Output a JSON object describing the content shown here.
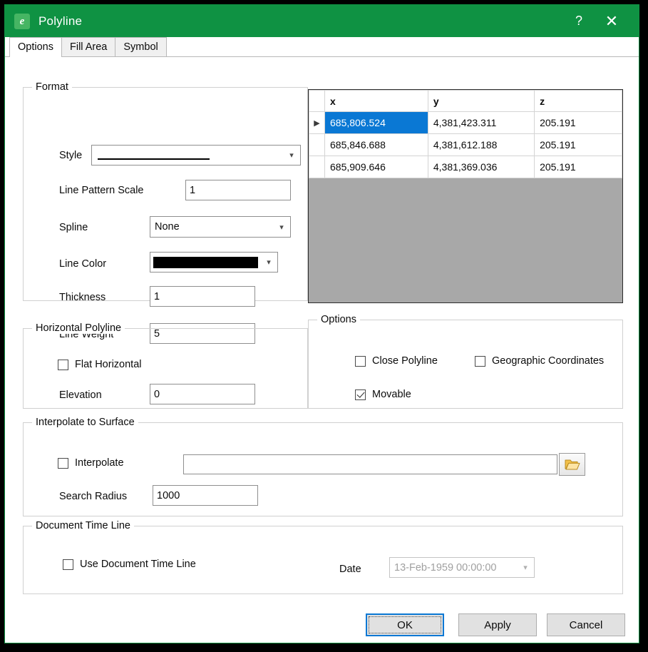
{
  "window": {
    "title": "Polyline",
    "icon": "app-icon-e",
    "help_label": "?",
    "close_label": "✕",
    "accent_color": "#0f9243"
  },
  "tabs": [
    {
      "label": "Options",
      "active": true
    },
    {
      "label": "Fill Area",
      "active": false
    },
    {
      "label": "Symbol",
      "active": false
    }
  ],
  "format": {
    "legend": "Format",
    "style_label": "Style",
    "style_value": "",
    "line_pattern_scale_label": "Line Pattern Scale",
    "line_pattern_scale_value": "1",
    "spline_label": "Spline",
    "spline_value": "None",
    "line_color_label": "Line Color",
    "line_color_value": "#000000",
    "thickness_label": "Thickness",
    "thickness_value": "1",
    "line_weight_label": "Line Weight",
    "line_weight_value": "5"
  },
  "horizontal_polyline": {
    "legend": "Horizontal Polyline",
    "flat_horizontal_label": "Flat Horizontal",
    "flat_horizontal_checked": false,
    "elevation_label": "Elevation",
    "elevation_value": "0"
  },
  "options": {
    "legend": "Options",
    "close_polyline_label": "Close Polyline",
    "close_polyline_checked": false,
    "geographic_coordinates_label": "Geographic Coordinates",
    "geographic_coordinates_checked": false,
    "movable_label": "Movable",
    "movable_checked": true
  },
  "interpolate": {
    "legend": "Interpolate to Surface",
    "interpolate_label": "Interpolate",
    "interpolate_checked": false,
    "surface_path_value": "",
    "browse_icon": "folder-open-icon",
    "search_radius_label": "Search Radius",
    "search_radius_value": "1000"
  },
  "document_time_line": {
    "legend": "Document Time Line",
    "use_label": "Use Document Time Line",
    "use_checked": false,
    "date_label": "Date",
    "date_value": "13-Feb-1959 00:00:00"
  },
  "coordinates_grid": {
    "columns": [
      "",
      "x",
      "y",
      "z"
    ],
    "rows": [
      {
        "marker": "▶",
        "x": "685,806.524",
        "y": "4,381,423.311",
        "z": "205.191",
        "selected": true
      },
      {
        "marker": "",
        "x": "685,846.688",
        "y": "4,381,612.188",
        "z": "205.191",
        "selected": false
      },
      {
        "marker": "",
        "x": "685,909.646",
        "y": "4,381,369.036",
        "z": "205.191",
        "selected": false
      }
    ]
  },
  "footer": {
    "ok_label": "OK",
    "apply_label": "Apply",
    "cancel_label": "Cancel"
  }
}
